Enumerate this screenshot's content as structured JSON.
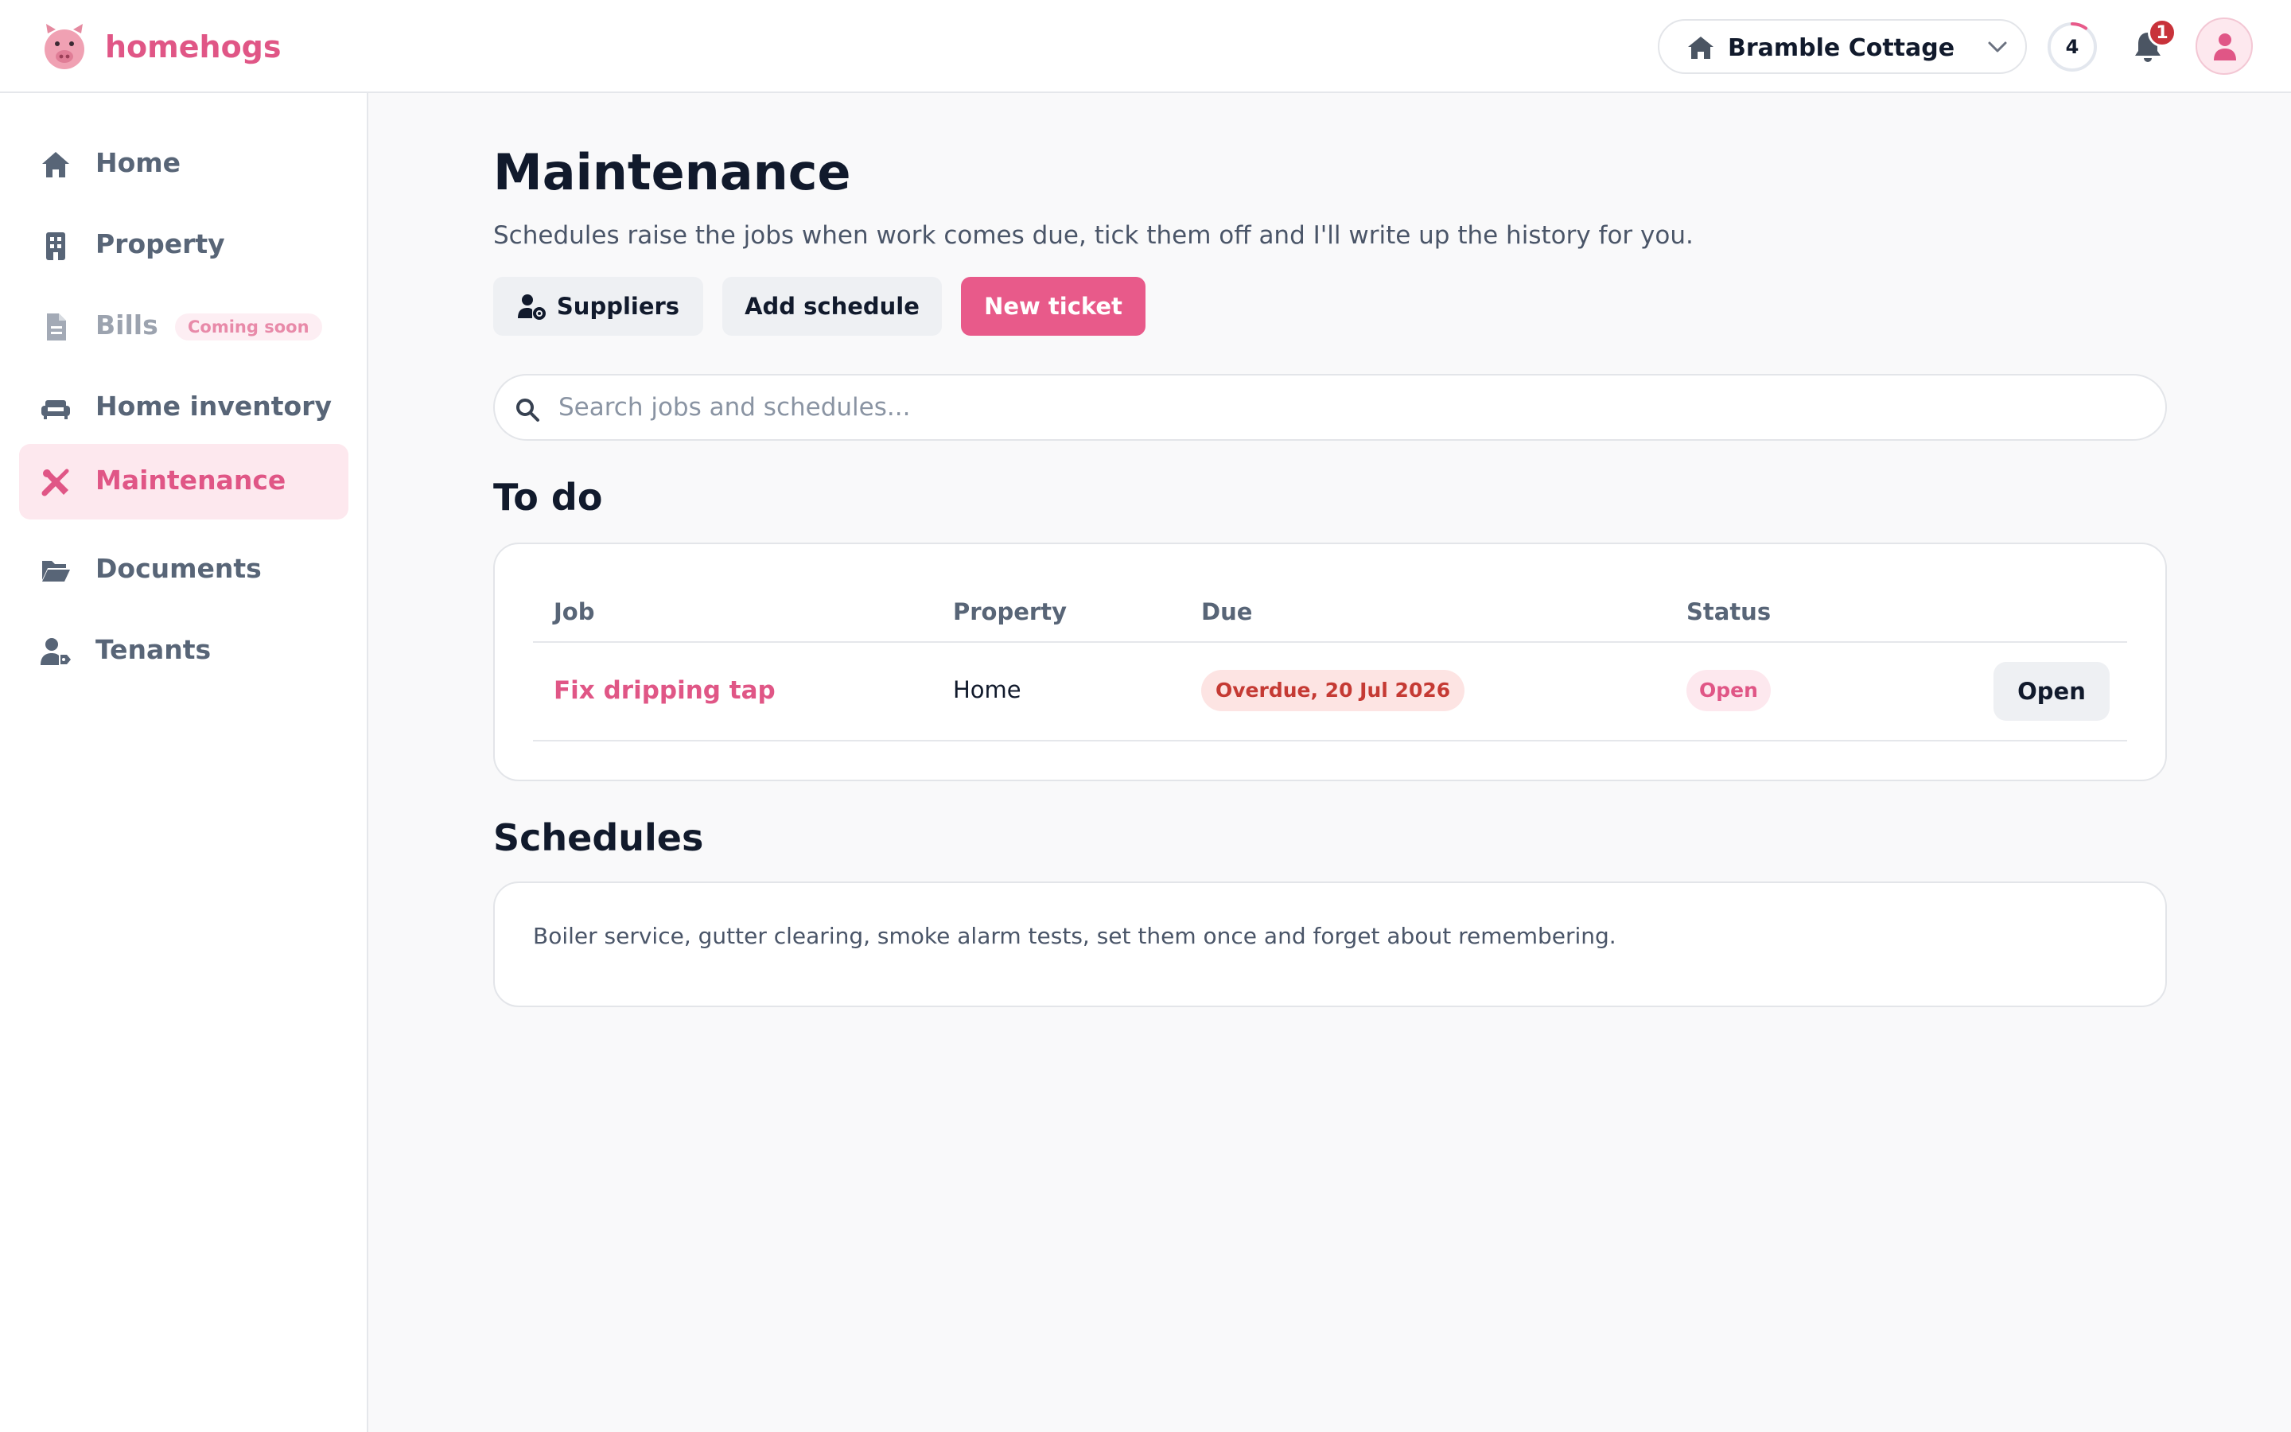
{
  "brand": {
    "name": "homehogs",
    "icon": "pig-logo"
  },
  "topbar": {
    "property_name": "Bramble Cottage",
    "progress_count": "4",
    "progress_fraction": 0.1,
    "notification_count": "1"
  },
  "sidebar": {
    "items": [
      {
        "label": "Home",
        "icon": "house-icon"
      },
      {
        "label": "Property",
        "icon": "building-icon"
      },
      {
        "label": "Bills",
        "icon": "file-icon",
        "badge": "Coming soon"
      },
      {
        "label": "Home inventory",
        "icon": "couch-icon"
      },
      {
        "label": "Maintenance",
        "icon": "tools-icon",
        "active": true
      },
      {
        "label": "Documents",
        "icon": "folder-open-icon"
      },
      {
        "label": "Tenants",
        "icon": "user-tag-icon"
      }
    ]
  },
  "main": {
    "title": "Maintenance",
    "subtitle": "Schedules raise the jobs when work comes due, tick them off and I'll write up the history for you.",
    "buttons": {
      "suppliers": "Suppliers",
      "add_schedule": "Add schedule",
      "new_ticket": "New ticket"
    },
    "search_placeholder": "Search jobs and schedules...",
    "todo": {
      "heading": "To do",
      "columns": [
        "Job",
        "Property",
        "Due",
        "Status"
      ],
      "rows": [
        {
          "job": "Fix dripping tap",
          "property": "Home",
          "due": "Overdue, 20 Jul 2026",
          "status": "Open",
          "action": "Open"
        }
      ]
    },
    "schedules": {
      "heading": "Schedules",
      "empty_text": "Boiler service, gutter clearing, smoke alarm tests, set them once and forget about remembering."
    }
  },
  "colors": {
    "accent": "#e05686",
    "primary_button": "#e85a8a",
    "overdue": "#c53a34",
    "text": "#111a2c",
    "muted": "#586577"
  }
}
